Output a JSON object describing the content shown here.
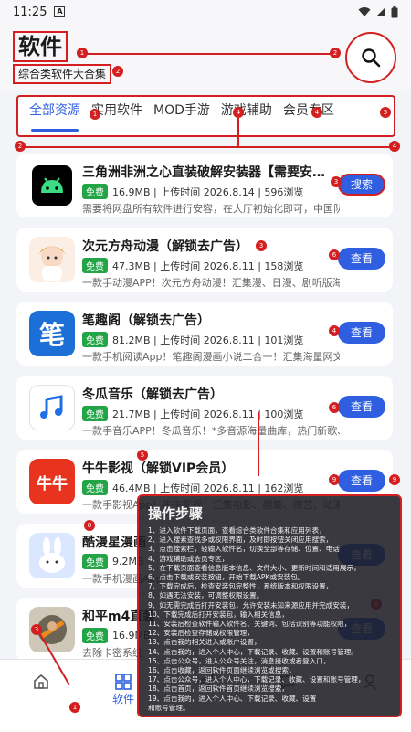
{
  "status_bar": {
    "time": "11:25",
    "a_icon": "A"
  },
  "header": {
    "title": "软件",
    "subtitle": "综合类软件大合集",
    "search_icon": "search-icon"
  },
  "tabs": [
    "全部资源",
    "实用软件",
    "MOD手游",
    "游戏辅助",
    "会员专区"
  ],
  "apps": [
    {
      "name": "三角洲非洲之心直装破解安装器【需要安…",
      "free": "免费",
      "meta": "16.9MB | 上传时间 2026.8.14 | 596浏览",
      "desc": "需要将网盘所有软件进行安容，在大厅初始化即可，中国队只…",
      "button": "搜索"
    },
    {
      "name": "次元方舟动漫（解锁去广告）",
      "free": "免费",
      "meta": "47.3MB | 上传时间 2026.8.11 | 158浏览",
      "desc": "一款手动漫APP！次元方舟动漫！汇集漫、日漫、剧听版海量…",
      "button": "查看"
    },
    {
      "name": "笔趣阁（解锁去广告）",
      "free": "免费",
      "meta": "81.2MB | 上传时间 2026.8.11 | 101浏览",
      "desc": "一款手机阅读App！笔趣阁漫画小说二合一！汇集海量网文与…",
      "button": "查看"
    },
    {
      "name": "冬瓜音乐（解锁去广告）",
      "free": "免费",
      "meta": "21.7MB | 上传时间 2026.8.11 | 100浏览",
      "desc": "一款手音乐APP！冬瓜音乐！*多音源海量曲库，热门新歌、…",
      "button": "查看"
    },
    {
      "name": "牛牛影视（解锁VIP会员）",
      "free": "免费",
      "meta": "46.4MB | 上传时间 2026.8.11 | 162浏览",
      "desc": "一款手影视App！牛牛影视！汇集电影、剧集、综艺、动漫海…",
      "button": "查看"
    },
    {
      "name": "酷漫星漫画",
      "free": "免费",
      "meta": "9.2MB",
      "desc": "一款手机漫画App",
      "button": "查看"
    },
    {
      "name": "和平m4直装",
      "free": "免费",
      "meta": "16.9MB",
      "desc": "去除卡密系统",
      "button": "查看"
    }
  ],
  "app_icons": {
    "android": "android-icon",
    "bi_char": "笔",
    "music": "music-note-icon",
    "niuniu": "牛牛"
  },
  "overlay": {
    "title": "操作步骤",
    "steps": [
      "1、进入软件下载页面，查看综合类软件合集和应用列表，",
      "2、进入搜素查找多或权限界面，及时即按钮关闭应用搜索，",
      "3、点击搜索栏，轻输入软件名，切换全部等存储、位置、电话",
      "4、游戏辅助或会员专区，",
      "5、在下载页面查看信息版本信息、文件大小、更新时间和适用展示，",
      "6、点击下载或安装按钮，开始下载APK或安装包。",
      "7、下载完成后，检查安装包完整性，系统版本和权限设置，",
      "8、如遇无法安装，可调整权限设置。",
      "9、如无需完成后打开安装包，允许安装未知来源应用并完成安装，",
      "10、下载完成后打开安装包，输入相关信息，",
      "11、安装后检查软件输入软件名、关键词、包括识别等功能权限，",
      "12、安装后检查存储或权限管理，",
      "13、点击我的相关进入或账户设置，",
      "14、点击我的，进入个人中心，下载记录、收藏、设置和账号管理。",
      "15、点击公众号，进入公众号关注，消息接收或者登入口，",
      "16、点击收藏，返回软件页面继续浏览或搜索，",
      "17、点击公众号，进入个人中心，下载记录、收藏、设置和账号管理，",
      "18、点击首页，返回软件首页继续浏览搜索，",
      "19、点击我的，进入个人中心、下载记录、收藏、设置",
      "和账号管理。"
    ]
  },
  "bottom_nav": [
    {
      "label": "",
      "icon": "home-icon"
    },
    {
      "label": "软件",
      "icon": "grid-icon"
    },
    {
      "label": "",
      "icon": "send-icon"
    },
    {
      "label": "",
      "icon": "message-icon"
    },
    {
      "label": "",
      "icon": "user-icon"
    }
  ],
  "colors": {
    "accent": "#2f5fe0",
    "annotation": "#d31f1f",
    "free_badge": "#22a447"
  },
  "annotation_numbers": [
    "1",
    "2",
    "3",
    "4",
    "5",
    "6",
    "7",
    "8",
    "9"
  ]
}
